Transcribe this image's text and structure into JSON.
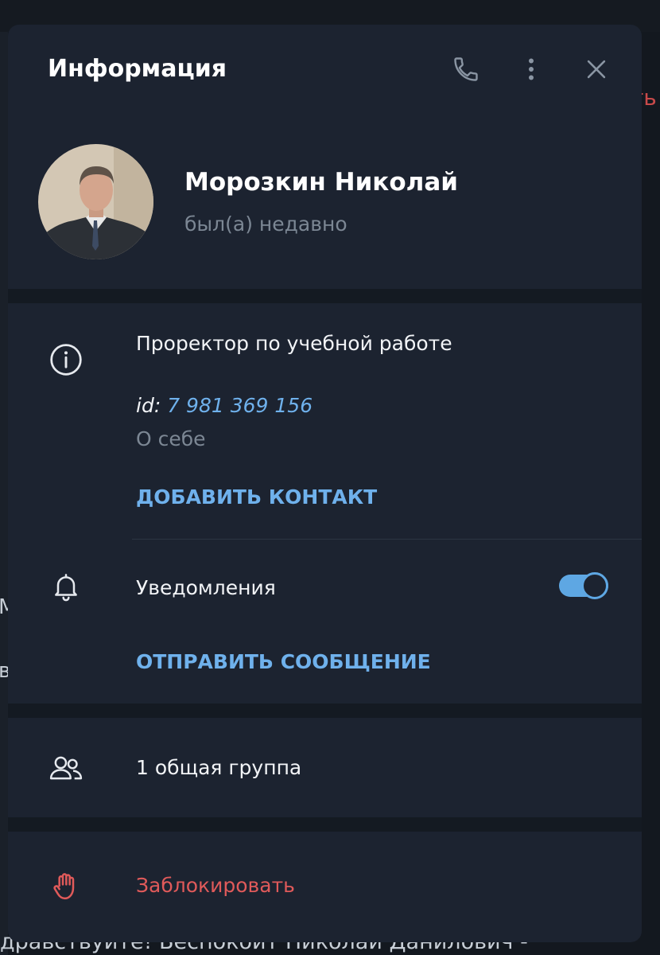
{
  "header": {
    "title": "Информация",
    "icons": [
      "phone-icon",
      "more-vertical-icon",
      "close-icon"
    ]
  },
  "profile": {
    "name": "Морозкин Николай",
    "status": "был(а) недавно"
  },
  "info": {
    "bio": "Проректор по учебной работе",
    "id_label": "id:",
    "id_value": "7 981 369 156",
    "about_label": "О себе",
    "add_contact": "ДОБАВИТЬ КОНТАКТ"
  },
  "notifications": {
    "label": "Уведомления",
    "enabled": true,
    "send_message": "ОТПРАВИТЬ СООБЩЕНИЕ"
  },
  "groups": {
    "label": "1 общая группа"
  },
  "block": {
    "label": "Заблокировать"
  },
  "background": {
    "fragment_right": "ть",
    "fragment_m": "М",
    "fragment_v": "в",
    "fragment_bottom": "дравствуйте! Беспокоит Николай Данилович -"
  },
  "colors": {
    "panel": "#1c2330",
    "accent": "#6fb1ec",
    "danger": "#e05a5a",
    "secondary_text": "#7c8794"
  }
}
